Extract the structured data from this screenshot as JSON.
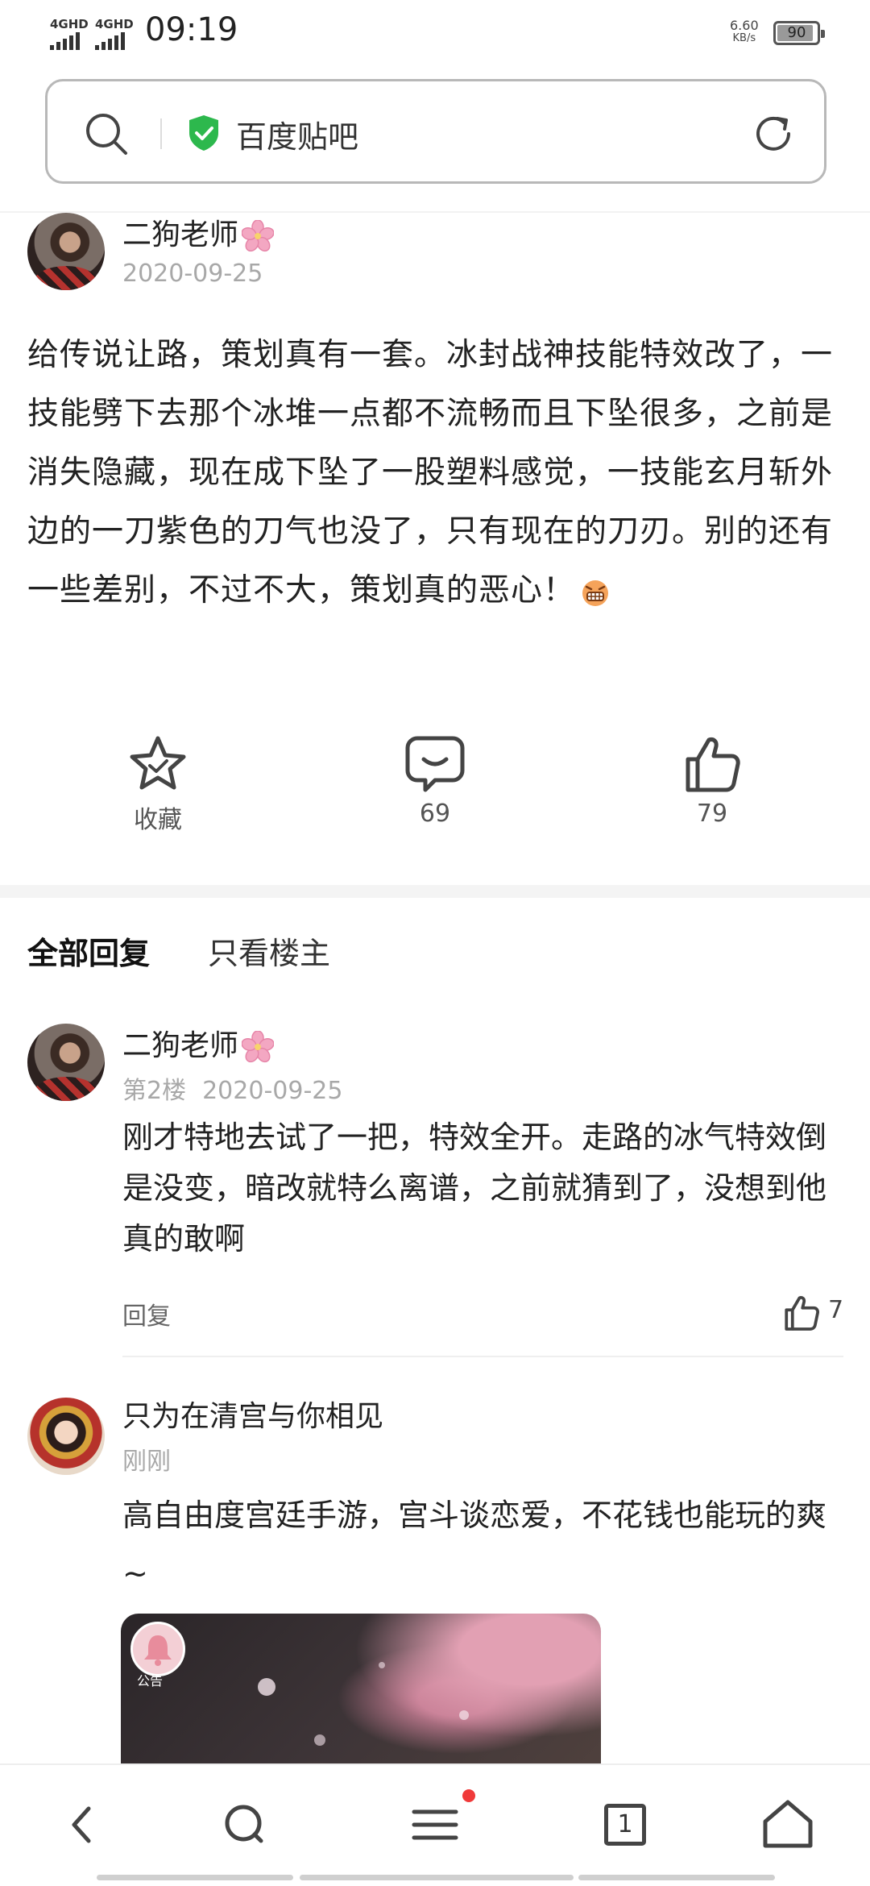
{
  "status_bar": {
    "signal1": "4GHD",
    "signal2": "4GHD",
    "time": "09:19",
    "net_speed": "6.60",
    "net_unit": "KB/s",
    "battery": "90"
  },
  "address_bar": {
    "site_name": "百度贴吧",
    "search_icon": "search-icon",
    "secure_icon": "shield-check-icon",
    "reload_icon": "reload-icon"
  },
  "post": {
    "author": "二狗老师",
    "date": "2020-09-25",
    "content": "给传说让路，策划真有一套。冰封战神技能特效改了，一技能劈下去那个冰堆一点都不流畅而且下坠很多，之前是消失隐藏，现在成下坠了一股塑料感觉，一技能玄月斩外边的一刀紫色的刀气也没了，只有现在的刀刃。别的还有一些差别，不过不大，策划真的恶心！",
    "actions": {
      "favorite": "收藏",
      "comments": "69",
      "likes": "79"
    }
  },
  "tabs": {
    "all_replies": "全部回复",
    "op_only": "只看楼主"
  },
  "replies": [
    {
      "author": "二狗老师",
      "floor": "第2楼",
      "date": "2020-09-25",
      "text": "刚才特地去试了一把，特效全开。走路的冰气特效倒是没变，暗改就特么离谱，之前就猜到了，没想到他真的敢啊",
      "reply_label": "回复",
      "likes": "7"
    },
    {
      "author": "只为在清宫与你相见",
      "time": "刚刚",
      "text": "高自由度宫廷手游，宫斗谈恋爱，不花钱也能玩的爽~",
      "badge_label": "公告"
    }
  ],
  "bottom_nav": {
    "tabs_count": "1"
  }
}
